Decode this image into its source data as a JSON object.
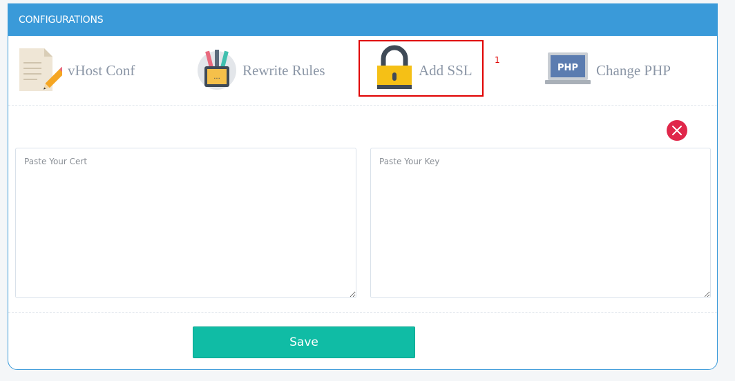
{
  "header": {
    "title": "CONFIGURATIONS"
  },
  "tabs": [
    {
      "label": "vHost Conf",
      "icon": "document-pencil-icon"
    },
    {
      "label": "Rewrite Rules",
      "icon": "pencil-cup-icon"
    },
    {
      "label": "Add SSL",
      "icon": "padlock-icon"
    },
    {
      "label": "Change PHP",
      "icon": "php-laptop-icon"
    }
  ],
  "annotation": {
    "marker": "1"
  },
  "form": {
    "cert_placeholder": "Paste Your Cert",
    "key_placeholder": "Paste Your Key",
    "save_label": "Save"
  },
  "colors": {
    "header": "#3a9ad9",
    "save": "#10bca5",
    "close": "#e0274a",
    "highlight": "#e00000"
  }
}
